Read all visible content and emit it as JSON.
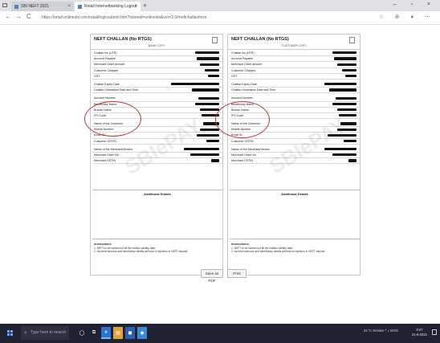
{
  "browser": {
    "tabs": [
      {
        "label": "SBI NEFT 2021",
        "active": false
      },
      {
        "label": "Retail Internetbanking Logout",
        "active": true
      }
    ],
    "new_tab": "+",
    "url": "https://retail.onlinesbi.com/retail/loginsubmit.htm?tokenid=onlinesbi&ver=2.0#neftchallanform",
    "nav_back": "←",
    "nav_forward": "→",
    "nav_reload": "C",
    "window_controls": "– ▫ ×",
    "toolbar_icons": "☆ ⊕ ♦ ⋯"
  },
  "challans": [
    {
      "title": "NEFT CHALLAN (No RTGS)",
      "copy_label": "BANK COPY",
      "rows": [
        {
          "label": "Challan No (UTR)",
          "redact": 30
        },
        {
          "label": "Account Payable",
          "redact": 28
        },
        {
          "label": "Merchant Order Amount",
          "redact": 24
        },
        {
          "label": "Customer Charges",
          "redact": 18
        },
        {
          "label": "GST",
          "redact": 14
        },
        {
          "label": "Challan Expiry Date",
          "redact": 60,
          "gap": true
        },
        {
          "label": "Challan Generation Date and Time",
          "redact": 34
        },
        {
          "label": "Account Number",
          "redact": 26,
          "gap": true
        },
        {
          "label": "Beneficiary Name",
          "redact": 30
        },
        {
          "label": "Branch Name",
          "redact": 24
        },
        {
          "label": "IFS Code",
          "redact": 22
        },
        {
          "label": "Name of the Customer",
          "redact": 20,
          "gap": true
        },
        {
          "label": "Mobile Number",
          "redact": 24
        },
        {
          "label": "Email ID",
          "redact": 28
        },
        {
          "label": "Customer GSTIN",
          "redact": 16
        },
        {
          "label": "Name of the Merchant/Vendor",
          "redact": 44,
          "gap": true
        },
        {
          "label": "Merchant Order No",
          "redact": 36
        },
        {
          "label": "Merchant GSTIN",
          "redact": 10
        }
      ],
      "additional_title": "Additional Details",
      "instructions_title": "Instructions",
      "instructions": [
        "1. NEFT to be carried out till the challan validity date.",
        "2. Incorrect amount and beneficiary details will lead to rejection in NEFT deposit."
      ]
    },
    {
      "title": "NEFT CHALLAN (No RTGS)",
      "copy_label": "CUSTOMER COPY",
      "rows": [
        {
          "label": "Challan No (UTR)",
          "redact": 30
        },
        {
          "label": "Account Payable",
          "redact": 28
        },
        {
          "label": "Merchant Order Amount",
          "redact": 24
        },
        {
          "label": "Customer Charges",
          "redact": 18
        },
        {
          "label": "GST",
          "redact": 14
        },
        {
          "label": "Challan Expiry Date",
          "redact": 40,
          "gap": true
        },
        {
          "label": "Challan Generation Date and Time",
          "redact": 34
        },
        {
          "label": "Account Number",
          "redact": 26,
          "gap": true
        },
        {
          "label": "Beneficiary Name",
          "redact": 30
        },
        {
          "label": "Branch Name",
          "redact": 24
        },
        {
          "label": "IFS Code",
          "redact": 22
        },
        {
          "label": "Name of the Customer",
          "redact": 20,
          "gap": true
        },
        {
          "label": "Mobile Number",
          "redact": 24
        },
        {
          "label": "Email ID",
          "redact": 36
        },
        {
          "label": "Customer GSTIN",
          "redact": 16
        },
        {
          "label": "Name of the Merchant/Vendor",
          "redact": 40,
          "gap": true
        },
        {
          "label": "Merchant Order No",
          "redact": 30
        },
        {
          "label": "Merchant GSTIN",
          "redact": 10
        }
      ],
      "additional_title": "Additional Details",
      "instructions_title": "Instructions",
      "instructions": [
        "1. NEFT to be carried out till the challan validity date.",
        "2. Incorrect amount and beneficiary details will lead to rejection in NEFT deposit."
      ]
    }
  ],
  "watermark": "SBIePAY",
  "buttons": {
    "save_pdf": "Save as PDF",
    "print": "Print"
  },
  "taskbar": {
    "search_placeholder": "Type here to search",
    "apps": [
      "◯",
      "⧉",
      "e",
      "▤",
      "◼",
      "◆"
    ],
    "tray": "31°C Smoke  ^  ♪  ENG",
    "time": "9:07",
    "date": "31-8-2021"
  },
  "colors": {
    "highlight_circle": "#c53a3a",
    "taskbar": "#1f2230"
  }
}
